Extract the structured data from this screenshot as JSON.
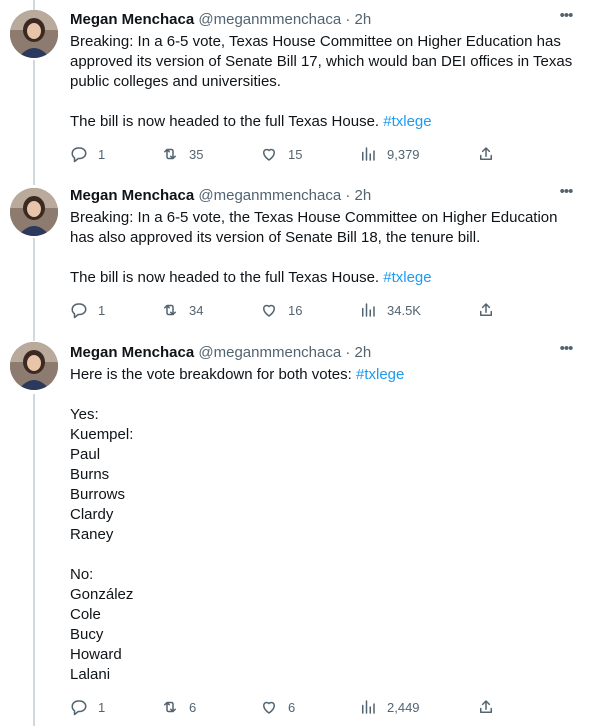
{
  "tweets": [
    {
      "name": "Megan Menchaca",
      "handle": "@meganmmenchaca",
      "separator": "·",
      "time": "2h",
      "text_1": "Breaking: In a 6-5 vote, Texas House Committee on Higher Education has approved its version of Senate Bill 17, which would ban DEI offices in Texas public colleges and universities.",
      "text_2": "The bill is now headed to the full Texas House.",
      "hashtag": "#txlege",
      "replies": "1",
      "retweets": "35",
      "likes": "15",
      "views": "9,379"
    },
    {
      "name": "Megan Menchaca",
      "handle": "@meganmmenchaca",
      "separator": "·",
      "time": "2h",
      "text_1": "Breaking: In a 6-5 vote, the Texas House Committee on Higher Education has also approved its version of Senate Bill 18, the tenure bill.",
      "text_2": "The bill is now headed to the full Texas House.",
      "hashtag": "#txlege",
      "replies": "1",
      "retweets": "34",
      "likes": "16",
      "views": "34.5K"
    },
    {
      "name": "Megan Menchaca",
      "handle": "@meganmmenchaca",
      "separator": "·",
      "time": "2h",
      "text_1": "Here is the vote breakdown for both votes:",
      "hashtag": "#txlege",
      "yes_heading": "Yes:",
      "yes_list": [
        "Kuempel:",
        "Paul",
        "Burns",
        "Burrows",
        "Clardy",
        "Raney"
      ],
      "no_heading": "No:",
      "no_list": [
        "González",
        "Cole",
        "Bucy",
        "Howard",
        "Lalani"
      ],
      "replies": "1",
      "retweets": "6",
      "likes": "6",
      "views": "2,449"
    }
  ],
  "icons": {
    "reply": "reply-icon",
    "retweet": "retweet-icon",
    "like": "like-icon",
    "views": "views-icon",
    "share": "share-icon",
    "more": "more-icon"
  },
  "colors": {
    "hashtag": "#1d9bf0",
    "secondary": "#536471",
    "thread_line": "#cfd9de"
  }
}
